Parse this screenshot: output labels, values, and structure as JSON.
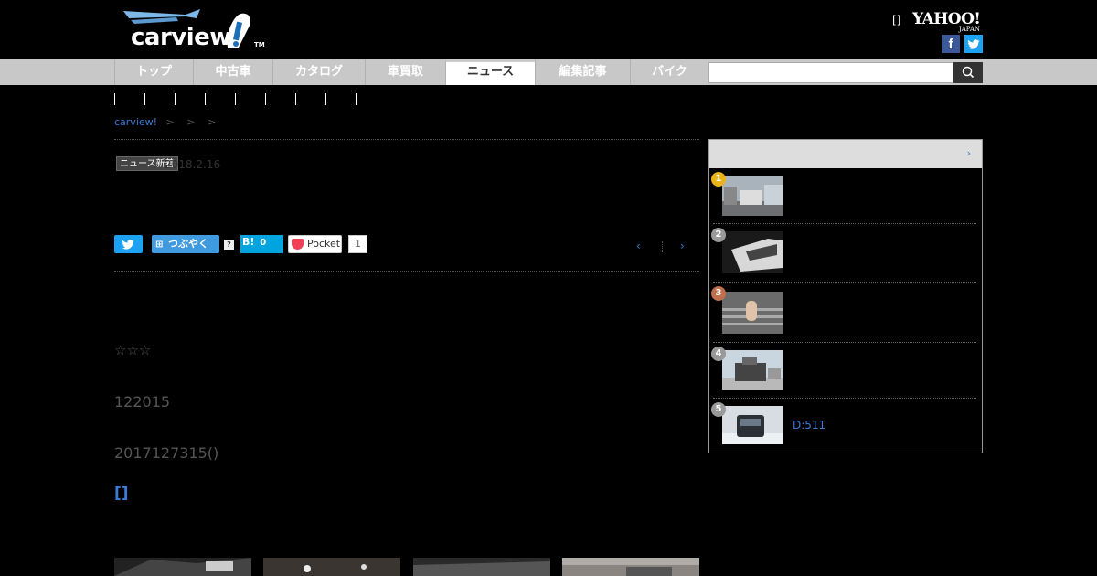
{
  "header": {
    "logo_text": "carview",
    "logo_tm": "TM",
    "bracket_link": "[]",
    "yahoo_main": "YAHOO!",
    "yahoo_sub": "JAPAN",
    "facebook_glyph": "f"
  },
  "nav": {
    "items": [
      "トップ",
      "中古車",
      "カタログ",
      "車買取",
      "ニュース",
      "編集記事",
      "バイク"
    ],
    "active": "ニュース",
    "search_placeholder": ""
  },
  "breadcrumb": {
    "home": "carview!",
    "sep1": ">",
    "sep2": ">",
    "sep3": ">"
  },
  "article": {
    "tag": "ニュース新着",
    "date": "2018.2.16",
    "share": {
      "tsubuyaku_label": "つぶやく",
      "help": "?",
      "hatena_label": "B!",
      "hatena_count": "0",
      "pocket_label": "Pocket",
      "pocket_count": "1"
    },
    "pager_prev": "‹",
    "pager_next": "›",
    "stars": "☆☆☆",
    "line1": "122015",
    "line2": "2017127315()",
    "bracket": "[]"
  },
  "sidebar": {
    "head_arrow": "›",
    "ranking": [
      {
        "rank": "1",
        "title": "",
        "badge_color": "#e8b41a"
      },
      {
        "rank": "2",
        "title": "",
        "badge_color": "#999999"
      },
      {
        "rank": "3",
        "title": "",
        "badge_color": "#c0704c"
      },
      {
        "rank": "4",
        "title": "",
        "badge_color": "#999999"
      },
      {
        "rank": "5",
        "title": "D:511",
        "badge_color": "#999999"
      }
    ]
  },
  "colors": {
    "accent": "#3a7bd5",
    "nav_bg": "#c8c8c8",
    "twitter": "#1da1f2",
    "facebook": "#3b5998"
  }
}
